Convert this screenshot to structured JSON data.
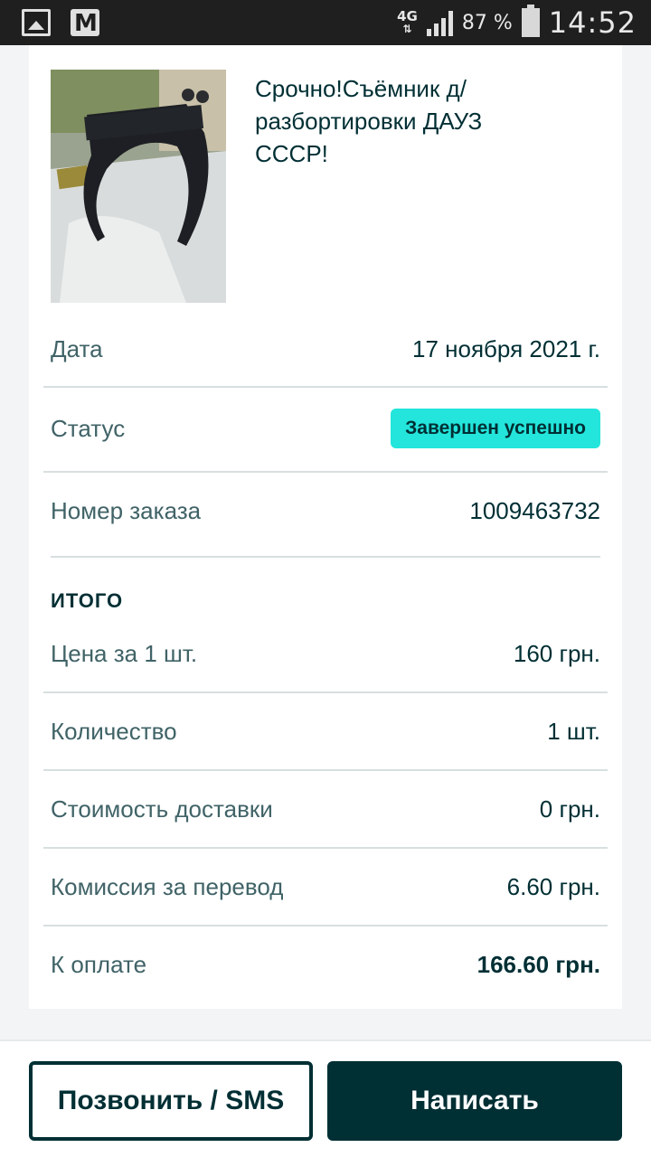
{
  "statusbar": {
    "network": "4G",
    "network_arrows": "⇅",
    "battery": "87 %",
    "time": "14:52",
    "icons": [
      "picture-icon",
      "gmail-icon",
      "signal-icon",
      "battery-icon"
    ]
  },
  "product": {
    "title": "Срочно!Съёмник д/разбортировки ДАУЗ СССР!"
  },
  "details": {
    "date_label": "Дата",
    "date_value": "17 ноября 2021 г.",
    "status_label": "Статус",
    "status_value": "Завершен успешно",
    "order_label": "Номер заказа",
    "order_value": "1009463732"
  },
  "total": {
    "heading": "ИТОГО",
    "price_label": "Цена за 1 шт.",
    "price_value": "160 грн.",
    "qty_label": "Количество",
    "qty_value": "1 шт.",
    "delivery_label": "Стоимость доставки",
    "delivery_value": "0 грн.",
    "fee_label": "Комиссия за перевод",
    "fee_value": "6.60 грн.",
    "pay_label": "К оплате",
    "pay_value": "166.60 грн."
  },
  "actions": {
    "call_label": "Позвонить / SMS",
    "write_label": "Написать"
  },
  "colors": {
    "accent": "#23e5db",
    "primary": "#002f34"
  }
}
